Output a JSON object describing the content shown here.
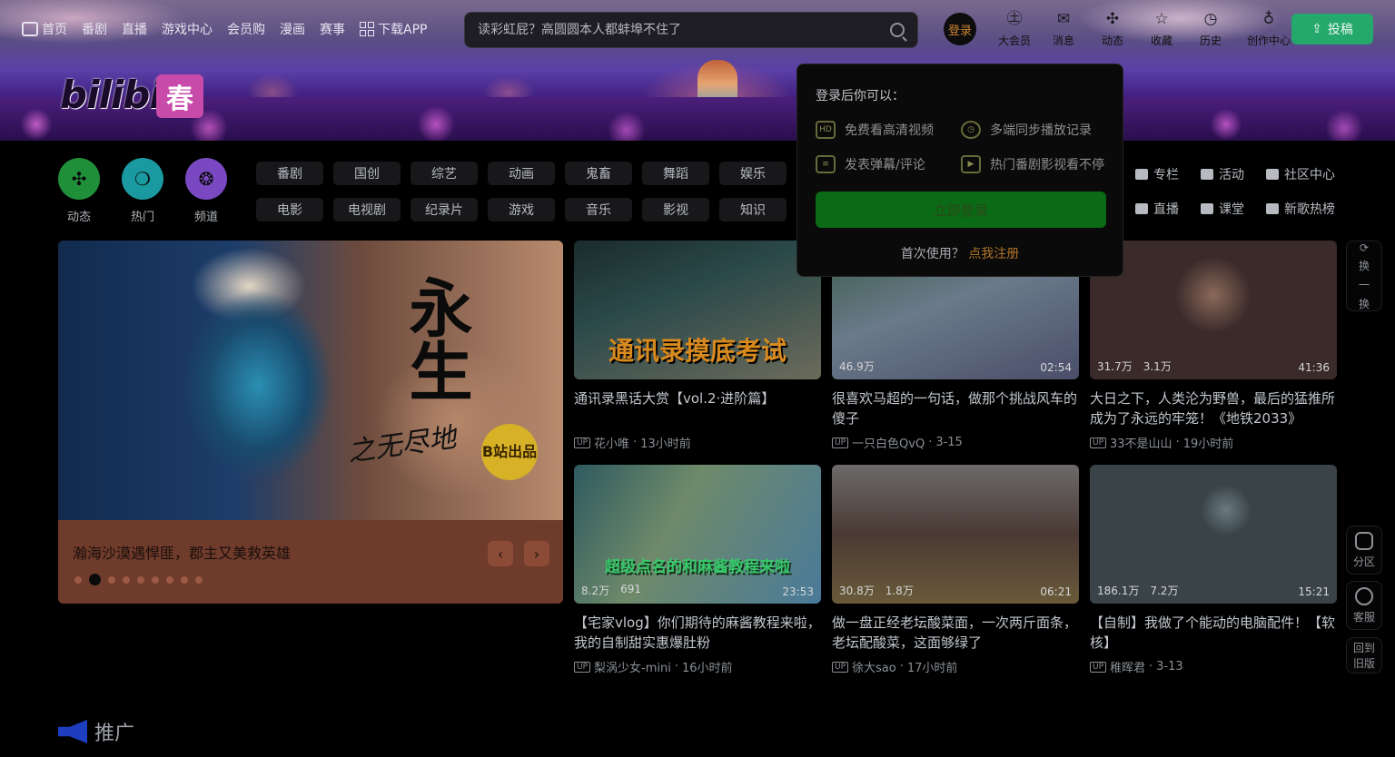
{
  "nav": {
    "items": [
      "首页",
      "番剧",
      "直播",
      "游戏中心",
      "会员购",
      "漫画",
      "赛事"
    ],
    "download": "下载APP"
  },
  "search": {
    "placeholder": "读彩虹屁？高圆圆本人都蚌埠不住了"
  },
  "login_avatar": "登录",
  "right_nav": [
    {
      "icon": "vip-icon",
      "glyph": "㊏",
      "label": "大会员"
    },
    {
      "icon": "message-icon",
      "glyph": "✉",
      "label": "消息"
    },
    {
      "icon": "dynamic-icon",
      "glyph": "✣",
      "label": "动态"
    },
    {
      "icon": "favorite-icon",
      "glyph": "☆",
      "label": "收藏"
    },
    {
      "icon": "history-icon",
      "glyph": "◷",
      "label": "历史"
    },
    {
      "icon": "creation-icon",
      "glyph": "♁",
      "label": "创作中心"
    }
  ],
  "upload_label": "投稿",
  "logo": {
    "text": "bilibili",
    "chip": "春"
  },
  "quick": [
    {
      "icon": "dynamic-icon",
      "glyph": "✣",
      "label": "动态",
      "color": "#1f8f3a"
    },
    {
      "icon": "hot-icon",
      "glyph": "❍",
      "label": "热门",
      "color": "#1a9aa0"
    },
    {
      "icon": "channel-icon",
      "glyph": "❂",
      "label": "频道",
      "color": "#7a49c2"
    }
  ],
  "categories": [
    "番剧",
    "国创",
    "综艺",
    "动画",
    "鬼畜",
    "舞蹈",
    "娱乐",
    "电影",
    "电视剧",
    "纪录片",
    "游戏",
    "音乐",
    "影视",
    "知识"
  ],
  "extra_links": [
    {
      "icon": "column-icon",
      "label": "专栏"
    },
    {
      "icon": "activity-icon",
      "label": "活动"
    },
    {
      "icon": "community-icon",
      "label": "社区中心"
    },
    {
      "icon": "live-icon",
      "label": "直播"
    },
    {
      "icon": "course-icon",
      "label": "课堂"
    },
    {
      "icon": "music-icon",
      "label": "新歌热榜"
    }
  ],
  "hero": {
    "art_title": "永生",
    "art_subtitle": "之无尽地",
    "badge": "B站出品",
    "caption": "瀚海沙漠遇悍匪，郡主又美救英雄",
    "dots": 9,
    "active_dot": 1
  },
  "videos": [
    {
      "title": "通讯录黑话大赏【vol.2·进阶篇】",
      "up": "花小唯",
      "time": "13小时前",
      "overlay": "通讯录摸底考试",
      "views": "",
      "danmaku": "",
      "duration": ""
    },
    {
      "title": "很喜欢马超的一句话，做那个挑战风车的傻子",
      "up": "一只白色QvQ",
      "time": "3-15",
      "overlay": "",
      "views": "46.9万",
      "danmaku": "",
      "duration": "02:54"
    },
    {
      "title": "大日之下，人类沦为野兽，最后的猛推所成为了永远的牢笼！《地铁2033》",
      "up": "33不是山山",
      "time": "19小时前",
      "overlay": "",
      "views": "31.7万",
      "danmaku": "3.1万",
      "duration": "41:36"
    },
    {
      "title": "【宅家vlog】你们期待的麻酱教程来啦，我的自制甜实惠爆肚粉",
      "up": "梨涡少女-mini",
      "time": "16小时前",
      "overlay": "超级点名的和麻酱教程来啦",
      "views": "8.2万",
      "danmaku": "691",
      "duration": "23:53"
    },
    {
      "title": "做一盘正经老坛酸菜面，一次两斤面条，老坛配酸菜，这面够绿了",
      "up": "徐大sao",
      "time": "17小时前",
      "overlay": "",
      "views": "30.8万",
      "danmaku": "1.8万",
      "duration": "06:21"
    },
    {
      "title": "【自制】我做了个能动的电脑配件！【软核】",
      "up": "稚晖君",
      "time": "3-13",
      "overlay": "",
      "views": "186.1万",
      "danmaku": "7.2万",
      "duration": "15:21"
    }
  ],
  "up_tag": "UP",
  "popover": {
    "head": "登录后你可以：",
    "features": [
      {
        "icon": "hd-icon",
        "glyph": "HD",
        "label": "免费看高清视频"
      },
      {
        "icon": "sync-icon",
        "glyph": "◷",
        "label": "多端同步播放记录"
      },
      {
        "icon": "comment-icon",
        "glyph": "≡",
        "label": "发表弹幕/评论"
      },
      {
        "icon": "play-icon",
        "glyph": "▶",
        "label": "热门番剧影视看不停"
      }
    ],
    "login": "立即登录",
    "first_use": "首次使用？",
    "register": "点我注册"
  },
  "side": {
    "refresh": [
      "换",
      "一",
      "换"
    ],
    "partition": "分区",
    "service": "客服",
    "old": [
      "回到",
      "旧版"
    ]
  },
  "promo": {
    "title": "推广"
  }
}
